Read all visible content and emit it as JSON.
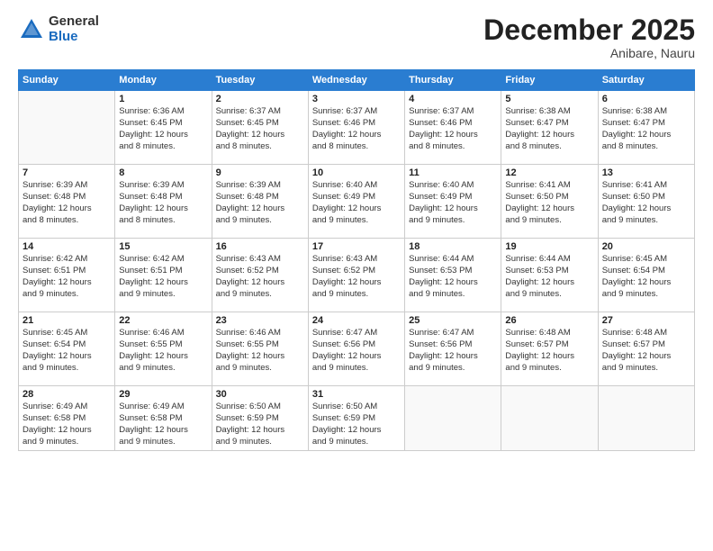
{
  "logo": {
    "general": "General",
    "blue": "Blue"
  },
  "header": {
    "month": "December 2025",
    "location": "Anibare, Nauru"
  },
  "weekdays": [
    "Sunday",
    "Monday",
    "Tuesday",
    "Wednesday",
    "Thursday",
    "Friday",
    "Saturday"
  ],
  "weeks": [
    [
      {
        "day": "",
        "info": ""
      },
      {
        "day": "1",
        "info": "Sunrise: 6:36 AM\nSunset: 6:45 PM\nDaylight: 12 hours\nand 8 minutes."
      },
      {
        "day": "2",
        "info": "Sunrise: 6:37 AM\nSunset: 6:45 PM\nDaylight: 12 hours\nand 8 minutes."
      },
      {
        "day": "3",
        "info": "Sunrise: 6:37 AM\nSunset: 6:46 PM\nDaylight: 12 hours\nand 8 minutes."
      },
      {
        "day": "4",
        "info": "Sunrise: 6:37 AM\nSunset: 6:46 PM\nDaylight: 12 hours\nand 8 minutes."
      },
      {
        "day": "5",
        "info": "Sunrise: 6:38 AM\nSunset: 6:47 PM\nDaylight: 12 hours\nand 8 minutes."
      },
      {
        "day": "6",
        "info": "Sunrise: 6:38 AM\nSunset: 6:47 PM\nDaylight: 12 hours\nand 8 minutes."
      }
    ],
    [
      {
        "day": "7",
        "info": "Sunrise: 6:39 AM\nSunset: 6:48 PM\nDaylight: 12 hours\nand 8 minutes."
      },
      {
        "day": "8",
        "info": "Sunrise: 6:39 AM\nSunset: 6:48 PM\nDaylight: 12 hours\nand 8 minutes."
      },
      {
        "day": "9",
        "info": "Sunrise: 6:39 AM\nSunset: 6:48 PM\nDaylight: 12 hours\nand 9 minutes."
      },
      {
        "day": "10",
        "info": "Sunrise: 6:40 AM\nSunset: 6:49 PM\nDaylight: 12 hours\nand 9 minutes."
      },
      {
        "day": "11",
        "info": "Sunrise: 6:40 AM\nSunset: 6:49 PM\nDaylight: 12 hours\nand 9 minutes."
      },
      {
        "day": "12",
        "info": "Sunrise: 6:41 AM\nSunset: 6:50 PM\nDaylight: 12 hours\nand 9 minutes."
      },
      {
        "day": "13",
        "info": "Sunrise: 6:41 AM\nSunset: 6:50 PM\nDaylight: 12 hours\nand 9 minutes."
      }
    ],
    [
      {
        "day": "14",
        "info": "Sunrise: 6:42 AM\nSunset: 6:51 PM\nDaylight: 12 hours\nand 9 minutes."
      },
      {
        "day": "15",
        "info": "Sunrise: 6:42 AM\nSunset: 6:51 PM\nDaylight: 12 hours\nand 9 minutes."
      },
      {
        "day": "16",
        "info": "Sunrise: 6:43 AM\nSunset: 6:52 PM\nDaylight: 12 hours\nand 9 minutes."
      },
      {
        "day": "17",
        "info": "Sunrise: 6:43 AM\nSunset: 6:52 PM\nDaylight: 12 hours\nand 9 minutes."
      },
      {
        "day": "18",
        "info": "Sunrise: 6:44 AM\nSunset: 6:53 PM\nDaylight: 12 hours\nand 9 minutes."
      },
      {
        "day": "19",
        "info": "Sunrise: 6:44 AM\nSunset: 6:53 PM\nDaylight: 12 hours\nand 9 minutes."
      },
      {
        "day": "20",
        "info": "Sunrise: 6:45 AM\nSunset: 6:54 PM\nDaylight: 12 hours\nand 9 minutes."
      }
    ],
    [
      {
        "day": "21",
        "info": "Sunrise: 6:45 AM\nSunset: 6:54 PM\nDaylight: 12 hours\nand 9 minutes."
      },
      {
        "day": "22",
        "info": "Sunrise: 6:46 AM\nSunset: 6:55 PM\nDaylight: 12 hours\nand 9 minutes."
      },
      {
        "day": "23",
        "info": "Sunrise: 6:46 AM\nSunset: 6:55 PM\nDaylight: 12 hours\nand 9 minutes."
      },
      {
        "day": "24",
        "info": "Sunrise: 6:47 AM\nSunset: 6:56 PM\nDaylight: 12 hours\nand 9 minutes."
      },
      {
        "day": "25",
        "info": "Sunrise: 6:47 AM\nSunset: 6:56 PM\nDaylight: 12 hours\nand 9 minutes."
      },
      {
        "day": "26",
        "info": "Sunrise: 6:48 AM\nSunset: 6:57 PM\nDaylight: 12 hours\nand 9 minutes."
      },
      {
        "day": "27",
        "info": "Sunrise: 6:48 AM\nSunset: 6:57 PM\nDaylight: 12 hours\nand 9 minutes."
      }
    ],
    [
      {
        "day": "28",
        "info": "Sunrise: 6:49 AM\nSunset: 6:58 PM\nDaylight: 12 hours\nand 9 minutes."
      },
      {
        "day": "29",
        "info": "Sunrise: 6:49 AM\nSunset: 6:58 PM\nDaylight: 12 hours\nand 9 minutes."
      },
      {
        "day": "30",
        "info": "Sunrise: 6:50 AM\nSunset: 6:59 PM\nDaylight: 12 hours\nand 9 minutes."
      },
      {
        "day": "31",
        "info": "Sunrise: 6:50 AM\nSunset: 6:59 PM\nDaylight: 12 hours\nand 9 minutes."
      },
      {
        "day": "",
        "info": ""
      },
      {
        "day": "",
        "info": ""
      },
      {
        "day": "",
        "info": ""
      }
    ]
  ]
}
